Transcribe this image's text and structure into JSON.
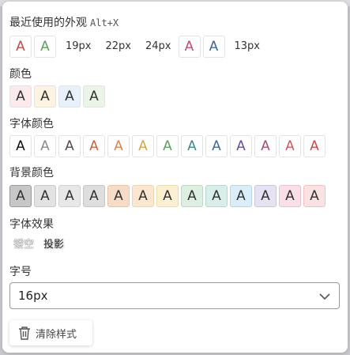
{
  "recent": {
    "title": "最近使用的外观",
    "hotkey": "Alt+X",
    "items": [
      {
        "type": "chip",
        "glyph": "A",
        "color": "#c84b4b",
        "bg": "#ffffff"
      },
      {
        "type": "chip",
        "glyph": "A",
        "color": "#5aa35a",
        "bg": "#ffffff"
      },
      {
        "type": "text",
        "label": "19px"
      },
      {
        "type": "text",
        "label": "22px"
      },
      {
        "type": "text",
        "label": "24px"
      },
      {
        "type": "chip",
        "glyph": "A",
        "color": "#c84b6c",
        "bg": "#ffffff"
      },
      {
        "type": "chip",
        "glyph": "A",
        "color": "#3b6aa0",
        "bg": "#ffffff"
      },
      {
        "type": "text",
        "label": "13px"
      }
    ]
  },
  "colors": {
    "title": "颜色",
    "items": [
      {
        "glyph": "A",
        "color": "#333333",
        "bg": "#fbe9ec"
      },
      {
        "glyph": "A",
        "color": "#333333",
        "bg": "#fdf3e0"
      },
      {
        "glyph": "A",
        "color": "#333333",
        "bg": "#e6f1fb"
      },
      {
        "glyph": "A",
        "color": "#333333",
        "bg": "#eaf5e8"
      }
    ]
  },
  "font_colors": {
    "title": "字体颜色",
    "items": [
      {
        "glyph": "A",
        "color": "#111111"
      },
      {
        "glyph": "A",
        "color": "#8c8c8c"
      },
      {
        "glyph": "A",
        "color": "#5b4b4b"
      },
      {
        "glyph": "A",
        "color": "#c8643c"
      },
      {
        "glyph": "A",
        "color": "#e0824b"
      },
      {
        "glyph": "A",
        "color": "#d9a23e"
      },
      {
        "glyph": "A",
        "color": "#5aa35a"
      },
      {
        "glyph": "A",
        "color": "#3d8a8a"
      },
      {
        "glyph": "A",
        "color": "#3b6aa0"
      },
      {
        "glyph": "A",
        "color": "#6a4ba0"
      },
      {
        "glyph": "A",
        "color": "#b04b6c"
      },
      {
        "glyph": "A",
        "color": "#d65a5a"
      },
      {
        "glyph": "A",
        "color": "#d04848"
      }
    ]
  },
  "bg_colors": {
    "title": "背景颜色",
    "items": [
      {
        "glyph": "A",
        "bg": "#c7c7c7",
        "border": "#9a9a9a"
      },
      {
        "glyph": "A",
        "bg": "#e2e2e2",
        "border": "#c9c9c9"
      },
      {
        "glyph": "A",
        "bg": "#e8e8e8",
        "border": "#d2d2d2"
      },
      {
        "glyph": "A",
        "bg": "#dedede",
        "border": "#c6c6c6"
      },
      {
        "glyph": "A",
        "bg": "#f6dcc6",
        "border": "#e9c6a6"
      },
      {
        "glyph": "A",
        "bg": "#fbe7cf",
        "border": "#efd2b0"
      },
      {
        "glyph": "A",
        "bg": "#fbf0d2",
        "border": "#ecdca8"
      },
      {
        "glyph": "A",
        "bg": "#dcefe1",
        "border": "#bcd9c3"
      },
      {
        "glyph": "A",
        "bg": "#d9eeea",
        "border": "#b7d8d1"
      },
      {
        "glyph": "A",
        "bg": "#dbeef7",
        "border": "#b9d7e6"
      },
      {
        "glyph": "A",
        "bg": "#e6e2f2",
        "border": "#cac3e3"
      },
      {
        "glyph": "A",
        "bg": "#f9dfe8",
        "border": "#eec0d0"
      },
      {
        "glyph": "A",
        "bg": "#fbe2e2",
        "border": "#efc3c3"
      }
    ]
  },
  "effects": {
    "title": "字体效果",
    "hollow_label": "镂空",
    "shadow_label": "投影"
  },
  "font_size": {
    "title": "字号",
    "value": "16px"
  },
  "clear_style": {
    "label": "清除样式"
  }
}
